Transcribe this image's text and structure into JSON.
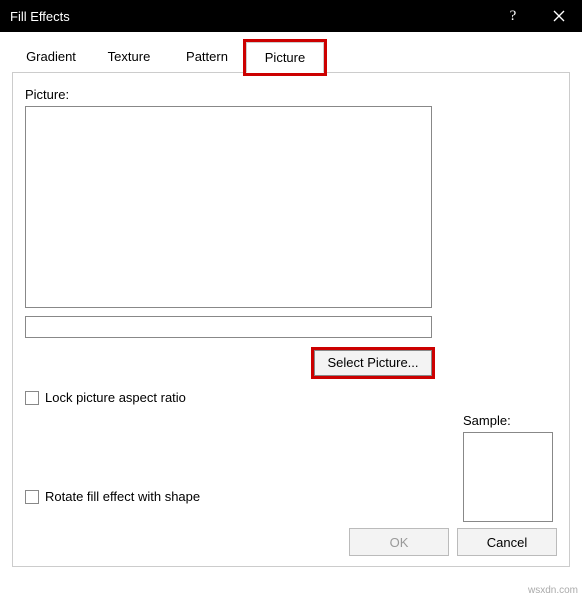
{
  "window": {
    "title": "Fill Effects"
  },
  "tabs": {
    "gradient": "Gradient",
    "texture": "Texture",
    "pattern": "Pattern",
    "picture": "Picture"
  },
  "panel": {
    "picture_label": "Picture:",
    "select_picture": "Select Picture...",
    "lock_aspect": "Lock picture aspect ratio",
    "sample_label": "Sample:",
    "rotate_fill": "Rotate fill effect with shape"
  },
  "footer": {
    "ok": "OK",
    "cancel": "Cancel"
  },
  "watermark": "wsxdn.com"
}
